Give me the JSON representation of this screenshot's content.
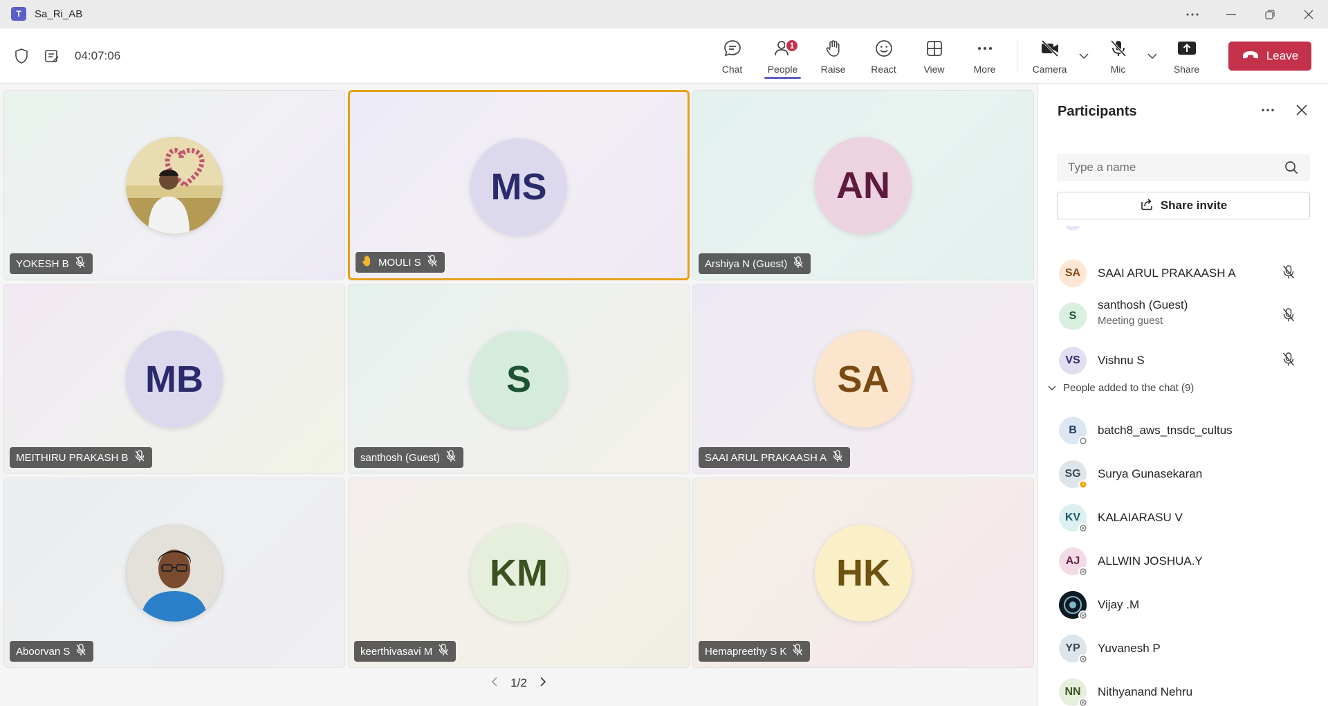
{
  "window": {
    "app_logo": "T",
    "title": "Sa_Ri_AB",
    "controls": [
      "more-options-icon",
      "minimize-icon",
      "restore-icon",
      "close-icon"
    ]
  },
  "toolbar": {
    "timer": "04:07:06",
    "buttons": {
      "chat": "Chat",
      "people": "People",
      "people_badge": "1",
      "raise": "Raise",
      "react": "React",
      "view": "View",
      "more": "More",
      "camera": "Camera",
      "mic": "Mic",
      "share": "Share",
      "leave": "Leave"
    }
  },
  "stage": {
    "tiles": [
      {
        "name": "YOKESH B",
        "avatar_type": "photo",
        "muted": true
      },
      {
        "name": "MOULI S",
        "initials": "MS",
        "hand_raised": true,
        "highlighted": true,
        "muted": true
      },
      {
        "name": "Arshiya N (Guest)",
        "initials": "AN",
        "muted": true
      },
      {
        "name": "MEITHIRU PRAKASH B",
        "initials": "MB",
        "muted": true
      },
      {
        "name": "santhosh (Guest)",
        "initials": "S",
        "muted": true
      },
      {
        "name": "SAAI ARUL PRAKAASH A",
        "initials": "SA",
        "muted": true
      },
      {
        "name": "Aboorvan S",
        "avatar_type": "photo",
        "muted": true
      },
      {
        "name": "keerthivasavi M",
        "initials": "KM",
        "muted": true
      },
      {
        "name": "Hemapreethy S K",
        "initials": "HK",
        "muted": true
      }
    ],
    "pager": "1/2"
  },
  "panel": {
    "title": "Participants",
    "search_placeholder": "Type a name",
    "share_invite": "Share invite",
    "in_meeting": [
      {
        "initials": "SA",
        "name": "SAAI ARUL PRAKAASH A",
        "muted": true
      },
      {
        "initials": "S",
        "name": "santhosh (Guest)",
        "subtitle": "Meeting guest",
        "muted": true
      },
      {
        "initials": "VS",
        "name": "Vishnu S",
        "muted": true
      }
    ],
    "chat_section_label": "People added to the chat (9)",
    "chat_members": [
      {
        "initials": "B",
        "name": "batch8_aws_tnsdc_cultus",
        "status": "offline"
      },
      {
        "initials": "SG",
        "name": "Surya Gunasekaran",
        "status": "away"
      },
      {
        "initials": "KV",
        "name": "KALAIARASU V",
        "status": "offline"
      },
      {
        "initials": "AJ",
        "name": "ALLWIN JOSHUA.Y",
        "status": "offline"
      },
      {
        "initials": "",
        "name": "Vijay .M",
        "status": "offline",
        "avatar_type": "photo"
      },
      {
        "initials": "YP",
        "name": "Yuvanesh P",
        "status": "offline"
      },
      {
        "initials": "NN",
        "name": "Nithyanand Nehru",
        "status": "offline"
      }
    ]
  },
  "colors": {
    "accent": "#5b5fc7",
    "leave": "#c4314b",
    "highlight": "#e6a117"
  }
}
